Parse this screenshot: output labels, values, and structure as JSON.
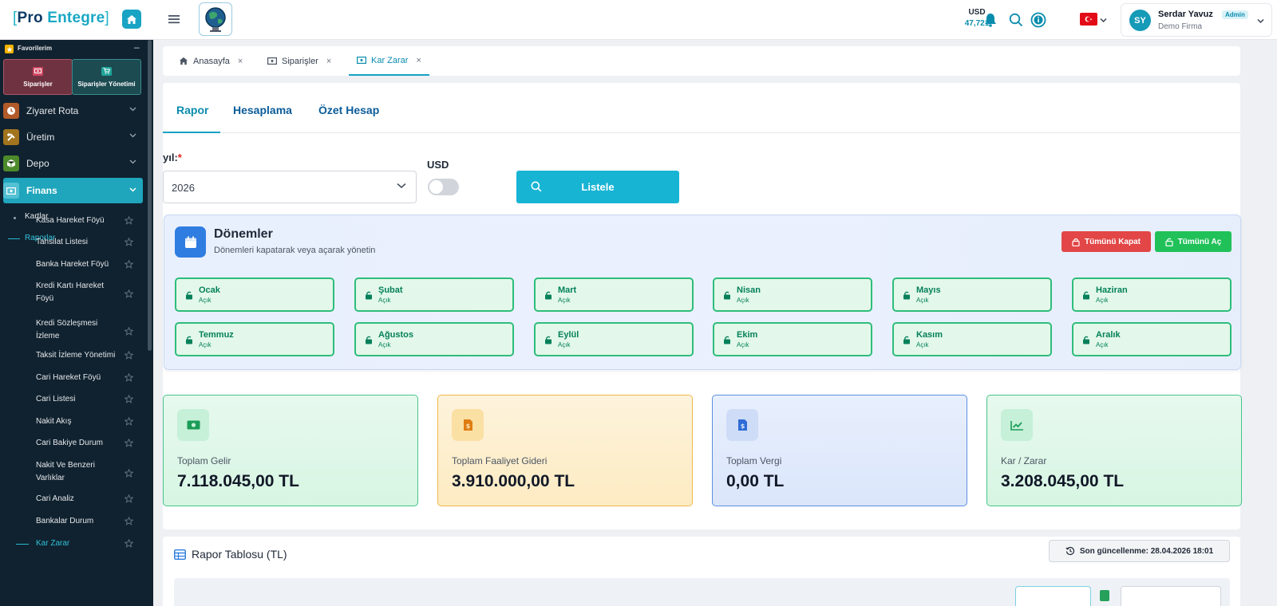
{
  "header": {
    "logo": {
      "bracket_open": "[",
      "word1": "Pro",
      "word2": "Entegre",
      "bracket_close": "]"
    },
    "currency": {
      "code": "USD",
      "value": "47,721"
    },
    "user": {
      "initials": "SY",
      "name": "Serdar Yavuz",
      "role": "Admin",
      "company": "Demo Firma"
    }
  },
  "sidebar": {
    "favorites": {
      "title": "Favorilerim",
      "minimize": "–",
      "items": [
        {
          "label": "Siparişler"
        },
        {
          "label": "Siparişler Yönetimi"
        }
      ]
    },
    "menu": [
      {
        "label": "Ziyaret Rota"
      },
      {
        "label": "Üretim"
      },
      {
        "label": "Depo"
      },
      {
        "label": "Finans"
      }
    ],
    "finans_sub": {
      "kartlar": "Kartlar",
      "raporlar": "Raporlar",
      "reports": [
        {
          "label1": "Kasa Hareket Föyü",
          "label2": ""
        },
        {
          "label1": "Tahsilat Listesi",
          "label2": ""
        },
        {
          "label1": "Banka Hareket Föyü",
          "label2": ""
        },
        {
          "label1": "Kredi Kartı Hareket",
          "label2": "Föyü"
        },
        {
          "label1": "Kredi Sözleşmesi",
          "label2": "İzleme"
        },
        {
          "label1": "Taksit İzleme Yönetimi",
          "label2": ""
        },
        {
          "label1": "Cari Hareket Föyü",
          "label2": ""
        },
        {
          "label1": "Cari Listesi",
          "label2": ""
        },
        {
          "label1": "Nakit Akış",
          "label2": ""
        },
        {
          "label1": "Cari Bakiye Durum",
          "label2": ""
        },
        {
          "label1": "Nakit Ve Benzeri",
          "label2": "Varlıklar"
        },
        {
          "label1": "Cari Analiz",
          "label2": ""
        },
        {
          "label1": "Bankalar Durum",
          "label2": ""
        },
        {
          "label1": "Kar Zarar",
          "label2": ""
        }
      ]
    }
  },
  "tabs": [
    {
      "label": "Anasayfa",
      "close": "×"
    },
    {
      "label": "Siparişler",
      "close": "×"
    },
    {
      "label": "Kar Zarar",
      "close": "×"
    }
  ],
  "subtabs": [
    "Rapor",
    "Hesaplama",
    "Özet Hesap"
  ],
  "form": {
    "yil_label": "yıl:",
    "required_mark": "*",
    "yil_value": "2026",
    "usd_label": "USD",
    "list_button": "Listele"
  },
  "periods": {
    "title": "Dönemler",
    "subtitle": "Dönemleri kapatarak veya açarak yönetin",
    "close_all": "Tümünü Kapat",
    "open_all": "Tümünü Aç",
    "months": [
      {
        "name": "Ocak",
        "status": "Açık"
      },
      {
        "name": "Şubat",
        "status": "Açık"
      },
      {
        "name": "Mart",
        "status": "Açık"
      },
      {
        "name": "Nisan",
        "status": "Açık"
      },
      {
        "name": "Mayıs",
        "status": "Açık"
      },
      {
        "name": "Haziran",
        "status": "Açık"
      },
      {
        "name": "Temmuz",
        "status": "Açık"
      },
      {
        "name": "Ağustos",
        "status": "Açık"
      },
      {
        "name": "Eylül",
        "status": "Açık"
      },
      {
        "name": "Ekim",
        "status": "Açık"
      },
      {
        "name": "Kasım",
        "status": "Açık"
      },
      {
        "name": "Aralık",
        "status": "Açık"
      }
    ]
  },
  "stats": [
    {
      "label": "Toplam Gelir",
      "value": "7.118.045,00 TL"
    },
    {
      "label": "Toplam Faaliyet Gideri",
      "value": "3.910.000,00 TL"
    },
    {
      "label": "Toplam Vergi",
      "value": "0,00 TL"
    },
    {
      "label": "Kar / Zarar",
      "value": "3.208.045,00 TL"
    }
  ],
  "report_table": {
    "title": "Rapor Tablosu (TL)",
    "last_update": "Son güncellenme: 28.04.2026 18:01"
  },
  "colors": {
    "accent": "#17b4d4",
    "sidebar_bg": "#10222f",
    "active_menu": "#1fa5bc",
    "period_green": "#2ebd7a",
    "danger": "#e24646",
    "success": "#21c15a"
  }
}
